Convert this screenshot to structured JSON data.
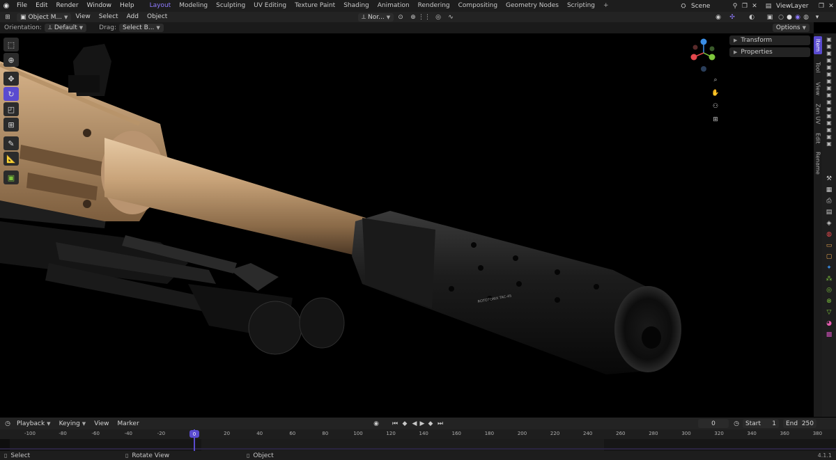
{
  "topbar": {
    "menus": [
      "File",
      "Edit",
      "Render",
      "Window",
      "Help"
    ],
    "workspaces": [
      "Layout",
      "Modeling",
      "Sculpting",
      "UV Editing",
      "Texture Paint",
      "Shading",
      "Animation",
      "Rendering",
      "Compositing",
      "Geometry Nodes",
      "Scripting"
    ],
    "active_workspace": "Layout",
    "add_tab": "+",
    "scene": "Scene",
    "view_layer": "ViewLayer"
  },
  "header": {
    "mode": "Object M...",
    "menus": [
      "View",
      "Select",
      "Add",
      "Object"
    ],
    "orientation_value": "Nor..."
  },
  "options_bar": {
    "orientation_label": "Orientation:",
    "orientation_value": "Default",
    "drag_label": "Drag:",
    "drag_value": "Select B...",
    "options": "Options"
  },
  "tools": [
    "select-box",
    "cursor",
    "move",
    "rotate",
    "scale",
    "transform",
    "annotate",
    "measure",
    "add-cube"
  ],
  "active_tool": "rotate",
  "npanel": {
    "sections": [
      "Transform",
      "Properties"
    ],
    "tabs": [
      "Item",
      "Tool",
      "View",
      "Zen UV",
      "Edit",
      "Rename"
    ],
    "active_tab": "Item"
  },
  "viewport": {
    "engraving": "ROTOTONIX TAC-45"
  },
  "gizmo": {
    "axes": [
      "X",
      "Y",
      "Z"
    ],
    "colors": {
      "x": "#e5484d",
      "y": "#7ec63c",
      "z": "#3a8ee6"
    }
  },
  "timeline": {
    "menus": [
      "Playback",
      "Keying",
      "View",
      "Marker"
    ],
    "current_frame": "0",
    "start_label": "Start",
    "start": "1",
    "end_label": "End",
    "end": "250",
    "ruler": [
      "-100",
      "-80",
      "-60",
      "-40",
      "-20",
      "0",
      "20",
      "40",
      "60",
      "80",
      "100",
      "120",
      "140",
      "160",
      "180",
      "200",
      "220",
      "240",
      "260",
      "280",
      "300",
      "320",
      "340",
      "360",
      "380"
    ]
  },
  "statusbar": {
    "select": "Select",
    "rotate": "Rotate View",
    "object": "Object",
    "version": "4.1.1"
  },
  "accent": "#5a4bd0"
}
